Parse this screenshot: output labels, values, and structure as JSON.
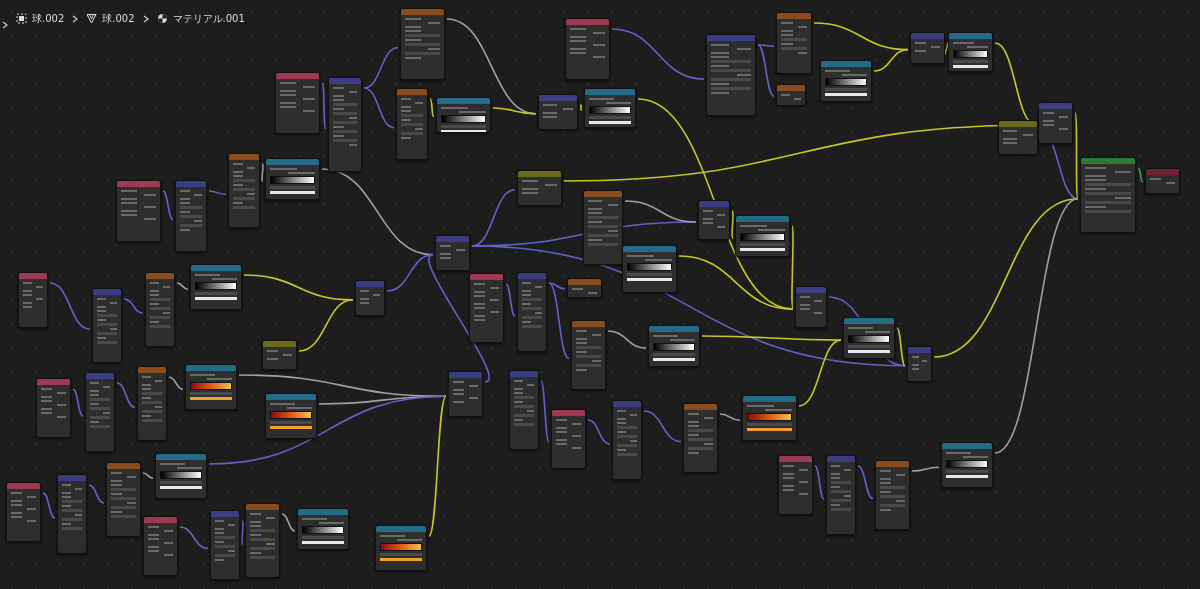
{
  "breadcrumb": [
    {
      "kind": "object",
      "label": "球.002"
    },
    {
      "kind": "mesh",
      "label": "球.002"
    },
    {
      "kind": "material",
      "label": "マテリアル.001"
    }
  ],
  "nodes": [
    {
      "kind": "texcoord"
    },
    {
      "kind": "mapping"
    },
    {
      "kind": "noise"
    },
    {
      "kind": "noise"
    },
    {
      "kind": "grayramp"
    },
    {
      "kind": "texcoord"
    },
    {
      "kind": "mapping"
    },
    {
      "kind": "noise"
    },
    {
      "kind": "noise"
    },
    {
      "kind": "mix"
    },
    {
      "kind": "grayramp"
    },
    {
      "kind": "grayramp"
    },
    {
      "kind": "mix"
    },
    {
      "kind": "grayramp"
    },
    {
      "kind": "mix"
    },
    {
      "kind": "combine"
    },
    {
      "kind": "bsdf"
    },
    {
      "kind": "output"
    },
    {
      "kind": "noise"
    },
    {
      "kind": "grayramp"
    },
    {
      "kind": "texcoord"
    },
    {
      "kind": "mapping"
    },
    {
      "kind": "combine"
    },
    {
      "kind": "mix"
    },
    {
      "kind": "noise"
    },
    {
      "kind": "mix"
    },
    {
      "kind": "grayramp"
    },
    {
      "kind": "grayramp"
    },
    {
      "kind": "texcoord"
    },
    {
      "kind": "mapping"
    },
    {
      "kind": "noise"
    },
    {
      "kind": "grayramp"
    },
    {
      "kind": "mix"
    },
    {
      "kind": "texcoord"
    },
    {
      "kind": "mapping"
    },
    {
      "kind": "noise"
    },
    {
      "kind": "noise"
    },
    {
      "kind": "grayramp"
    },
    {
      "kind": "mix"
    },
    {
      "kind": "grayramp"
    },
    {
      "kind": "mix"
    },
    {
      "kind": "combine"
    },
    {
      "kind": "texcoord"
    },
    {
      "kind": "mapping"
    },
    {
      "kind": "noise"
    },
    {
      "kind": "fireramp"
    },
    {
      "kind": "fireramp"
    },
    {
      "kind": "mix"
    },
    {
      "kind": "mapping"
    },
    {
      "kind": "texcoord"
    },
    {
      "kind": "mapping"
    },
    {
      "kind": "noise"
    },
    {
      "kind": "fireramp"
    },
    {
      "kind": "texcoord"
    },
    {
      "kind": "mapping"
    },
    {
      "kind": "noise"
    },
    {
      "kind": "grayramp"
    },
    {
      "kind": "texcoord"
    },
    {
      "kind": "mapping"
    },
    {
      "kind": "noise"
    },
    {
      "kind": "grayramp"
    },
    {
      "kind": "texcoord"
    },
    {
      "kind": "mapping"
    },
    {
      "kind": "noise"
    },
    {
      "kind": "grayramp"
    },
    {
      "kind": "fireramp"
    }
  ]
}
